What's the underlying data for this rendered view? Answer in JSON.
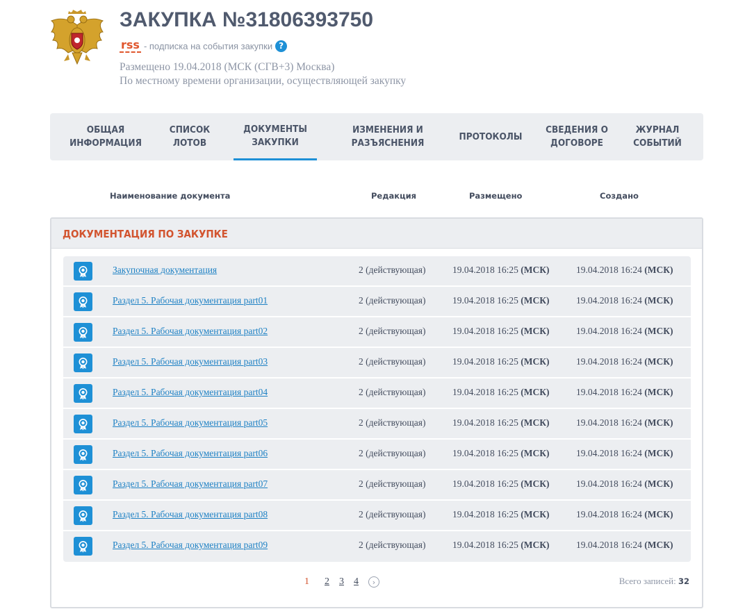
{
  "header": {
    "title": "ЗАКУПКА №31806393750",
    "rss_label": "rss",
    "rss_desc": "- подписка на события закупки",
    "help": "?",
    "posted": "Размещено 19.04.2018 (МСК (СГВ+3) Москва)",
    "posted_sub": "По местному времени организации, осуществляющей закупку"
  },
  "tabs": [
    {
      "label": "ОБЩАЯ\nИНФОРМАЦИЯ"
    },
    {
      "label": "СПИСОК\nЛОТОВ"
    },
    {
      "label": "ДОКУМЕНТЫ\nЗАКУПКИ",
      "active": true
    },
    {
      "label": "ИЗМЕНЕНИЯ И\nРАЗЪЯСНЕНИЯ"
    },
    {
      "label": "ПРОТОКОЛЫ"
    },
    {
      "label": "СВЕДЕНИЯ О\nДОГОВОРЕ"
    },
    {
      "label": "ЖУРНАЛ\nСОБЫТИЙ"
    }
  ],
  "columns": {
    "name": "Наименование документа",
    "edition": "Редакция",
    "posted": "Размещено",
    "created": "Создано"
  },
  "section": {
    "title": "ДОКУМЕНТАЦИЯ ПО ЗАКУПКЕ"
  },
  "documents": [
    {
      "name": "Закупочная документация",
      "edition": "2 (действующая)",
      "posted": "19.04.2018 16:25",
      "posted_tz": "(МСК)",
      "created": "19.04.2018 16:24",
      "created_tz": "(МСК)"
    },
    {
      "name": "Раздел 5. Рабочая документация part01",
      "edition": "2 (действующая)",
      "posted": "19.04.2018 16:25",
      "posted_tz": "(МСК)",
      "created": "19.04.2018 16:24",
      "created_tz": "(МСК)"
    },
    {
      "name": "Раздел 5. Рабочая документация part02",
      "edition": "2 (действующая)",
      "posted": "19.04.2018 16:25",
      "posted_tz": "(МСК)",
      "created": "19.04.2018 16:24",
      "created_tz": "(МСК)"
    },
    {
      "name": "Раздел 5. Рабочая документация part03",
      "edition": "2 (действующая)",
      "posted": "19.04.2018 16:25",
      "posted_tz": "(МСК)",
      "created": "19.04.2018 16:24",
      "created_tz": "(МСК)"
    },
    {
      "name": "Раздел 5. Рабочая документация part04",
      "edition": "2 (действующая)",
      "posted": "19.04.2018 16:25",
      "posted_tz": "(МСК)",
      "created": "19.04.2018 16:24",
      "created_tz": "(МСК)"
    },
    {
      "name": "Раздел 5. Рабочая документация part05",
      "edition": "2 (действующая)",
      "posted": "19.04.2018 16:25",
      "posted_tz": "(МСК)",
      "created": "19.04.2018 16:24",
      "created_tz": "(МСК)"
    },
    {
      "name": "Раздел 5. Рабочая документация part06",
      "edition": "2 (действующая)",
      "posted": "19.04.2018 16:25",
      "posted_tz": "(МСК)",
      "created": "19.04.2018 16:24",
      "created_tz": "(МСК)"
    },
    {
      "name": "Раздел 5. Рабочая документация part07",
      "edition": "2 (действующая)",
      "posted": "19.04.2018 16:25",
      "posted_tz": "(МСК)",
      "created": "19.04.2018 16:24",
      "created_tz": "(МСК)"
    },
    {
      "name": "Раздел 5. Рабочая документация part08",
      "edition": "2 (действующая)",
      "posted": "19.04.2018 16:25",
      "posted_tz": "(МСК)",
      "created": "19.04.2018 16:24",
      "created_tz": "(МСК)"
    },
    {
      "name": "Раздел 5. Рабочая документация part09",
      "edition": "2 (действующая)",
      "posted": "19.04.2018 16:25",
      "posted_tz": "(МСК)",
      "created": "19.04.2018 16:24",
      "created_tz": "(МСК)"
    }
  ],
  "pagination": {
    "pages": [
      "1",
      "2",
      "3",
      "4"
    ],
    "current": "1",
    "next_icon": "chevron-right-icon",
    "total_label": "Всего записей:",
    "total_value": "32"
  },
  "colors": {
    "accent": "#1e90d6",
    "section_title": "#d2542f",
    "rss": "#e0562d",
    "link": "#1e81c4"
  }
}
